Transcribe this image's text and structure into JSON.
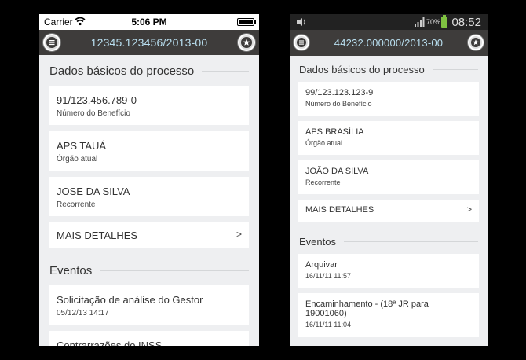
{
  "ios": {
    "status": {
      "carrier": "Carrier",
      "time": "5:06 PM"
    },
    "header": {
      "title": "12345.123456/2013-00"
    },
    "section_basic": "Dados básicos do processo",
    "cards": [
      {
        "primary": "91/123.456.789-0",
        "secondary": "Número do Benefício"
      },
      {
        "primary": "APS TAUÁ",
        "secondary": "Órgão atual"
      },
      {
        "primary": "JOSE DA SILVA",
        "secondary": "Recorrente"
      }
    ],
    "more": {
      "label": "MAIS DETALHES",
      "chevron": ">"
    },
    "section_events": "Eventos",
    "events": [
      {
        "primary": "Solicitação de análise do Gestor",
        "secondary": "05/12/13 14:17"
      },
      {
        "primary": "Contrarrazões do INSS",
        "secondary": ""
      }
    ]
  },
  "android": {
    "status": {
      "battery_pct": "70%",
      "time": "08:52"
    },
    "header": {
      "title": "44232.000000/2013-00"
    },
    "section_basic": "Dados básicos do processo",
    "cards": [
      {
        "primary": "99/123.123.123-9",
        "secondary": "Número do Benefício"
      },
      {
        "primary": "APS BRASÍLIA",
        "secondary": "Órgão atual"
      },
      {
        "primary": "JOÃO DA SILVA",
        "secondary": "Recorrente"
      }
    ],
    "more": {
      "label": "MAIS DETALHES",
      "chevron": ">"
    },
    "section_events": "Eventos",
    "events": [
      {
        "primary": "Arquivar",
        "secondary": "16/11/11 11:57"
      },
      {
        "primary": "Encaminhamento - (18ª JR para 19001060)",
        "secondary": "16/11/11 11:04"
      }
    ]
  },
  "icons": {
    "menu": "menu-icon",
    "star": "star-icon",
    "wifi": "wifi-icon",
    "volume": "volume-icon",
    "signal": "signal-icon",
    "battery": "battery-icon"
  },
  "colors": {
    "header_bg": "#3e3c3b",
    "header_text": "#b9dff0",
    "page_bg": "#eeeff1",
    "battery_green": "#7fc241"
  }
}
